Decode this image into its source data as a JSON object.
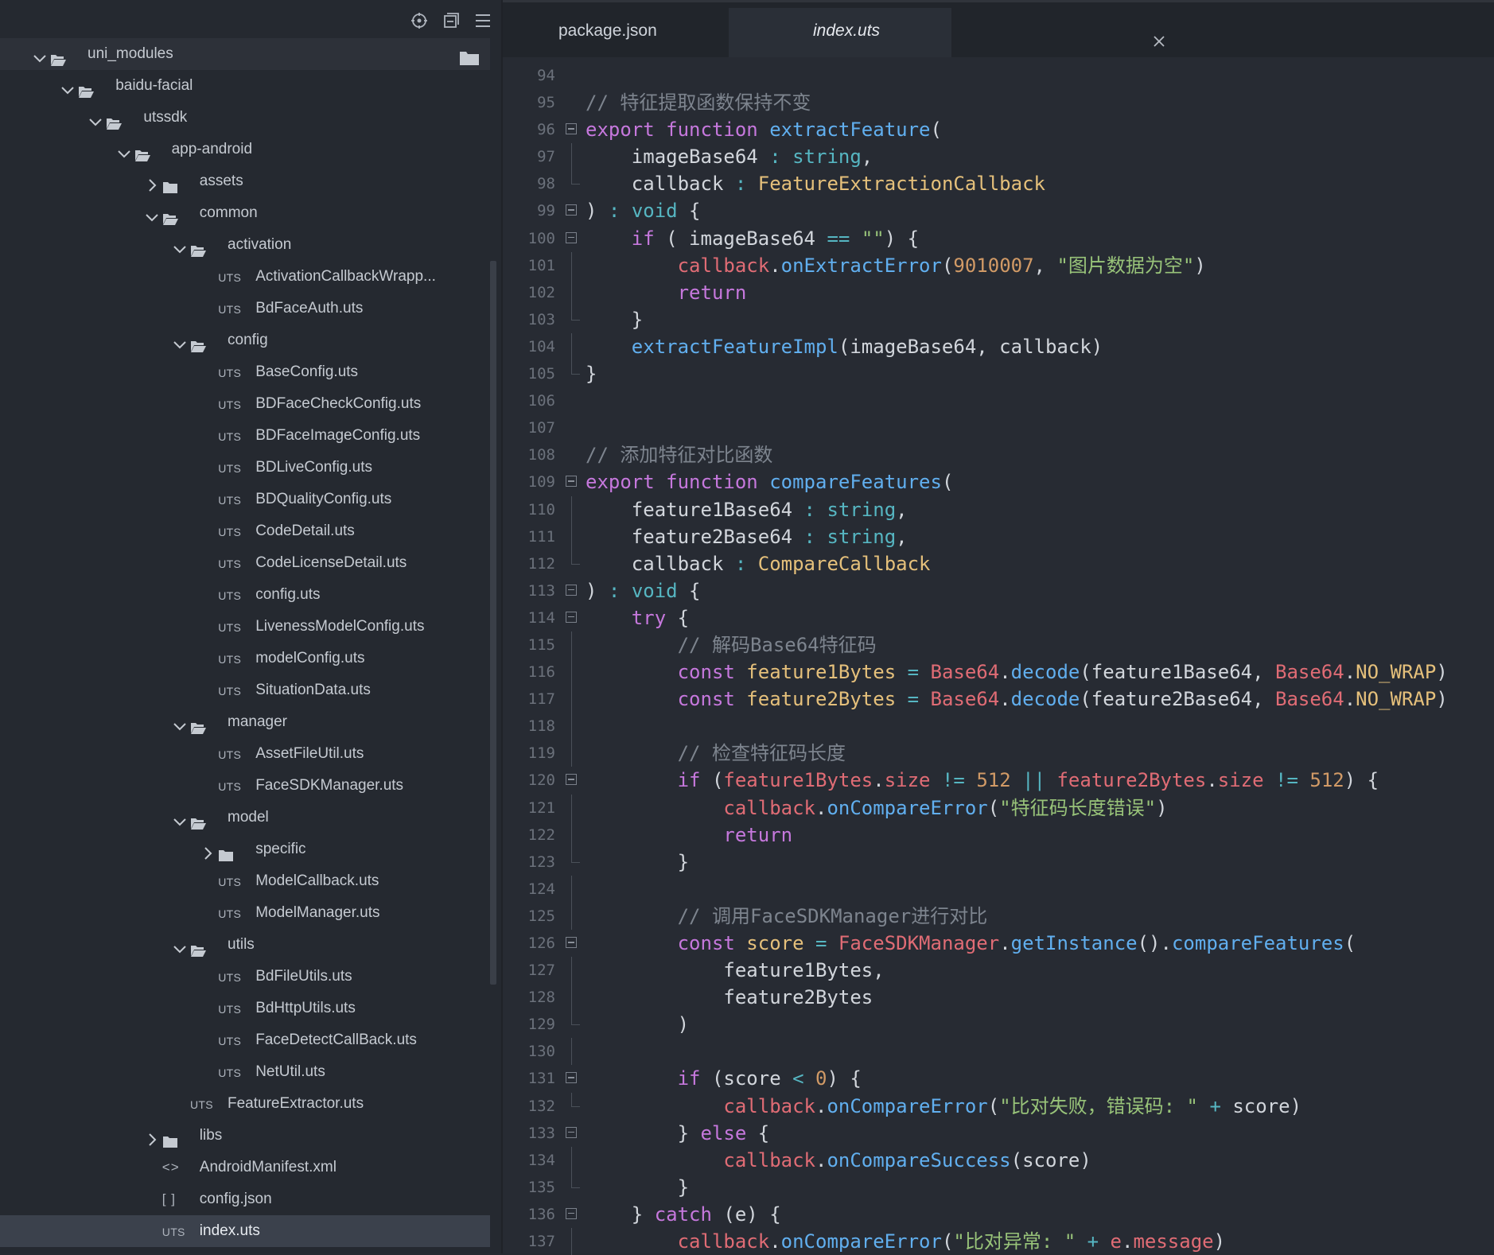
{
  "sidebar": {
    "tree": [
      {
        "label": "uni_modules",
        "kind": "folder",
        "depth": 0,
        "state": "open",
        "end_folder_icon": true
      },
      {
        "label": "baidu-facial",
        "kind": "folder",
        "depth": 1,
        "state": "open"
      },
      {
        "label": "utssdk",
        "kind": "folder",
        "depth": 2,
        "state": "open"
      },
      {
        "label": "app-android",
        "kind": "folder",
        "depth": 3,
        "state": "open"
      },
      {
        "label": "assets",
        "kind": "folder",
        "depth": 4,
        "state": "closed"
      },
      {
        "label": "common",
        "kind": "folder",
        "depth": 4,
        "state": "open"
      },
      {
        "label": "activation",
        "kind": "folder",
        "depth": 5,
        "state": "open"
      },
      {
        "label": "ActivationCallbackWrapp...",
        "kind": "uts",
        "depth": 6
      },
      {
        "label": "BdFaceAuth.uts",
        "kind": "uts",
        "depth": 6
      },
      {
        "label": "config",
        "kind": "folder",
        "depth": 5,
        "state": "open"
      },
      {
        "label": "BaseConfig.uts",
        "kind": "uts",
        "depth": 6
      },
      {
        "label": "BDFaceCheckConfig.uts",
        "kind": "uts",
        "depth": 6
      },
      {
        "label": "BDFaceImageConfig.uts",
        "kind": "uts",
        "depth": 6
      },
      {
        "label": "BDLiveConfig.uts",
        "kind": "uts",
        "depth": 6
      },
      {
        "label": "BDQualityConfig.uts",
        "kind": "uts",
        "depth": 6
      },
      {
        "label": "CodeDetail.uts",
        "kind": "uts",
        "depth": 6
      },
      {
        "label": "CodeLicenseDetail.uts",
        "kind": "uts",
        "depth": 6
      },
      {
        "label": "config.uts",
        "kind": "uts",
        "depth": 6
      },
      {
        "label": "LivenessModelConfig.uts",
        "kind": "uts",
        "depth": 6
      },
      {
        "label": "modelConfig.uts",
        "kind": "uts",
        "depth": 6
      },
      {
        "label": "SituationData.uts",
        "kind": "uts",
        "depth": 6
      },
      {
        "label": "manager",
        "kind": "folder",
        "depth": 5,
        "state": "open"
      },
      {
        "label": "AssetFileUtil.uts",
        "kind": "uts",
        "depth": 6
      },
      {
        "label": "FaceSDKManager.uts",
        "kind": "uts",
        "depth": 6
      },
      {
        "label": "model",
        "kind": "folder",
        "depth": 5,
        "state": "open"
      },
      {
        "label": "specific",
        "kind": "folder",
        "depth": 6,
        "state": "closed"
      },
      {
        "label": "ModelCallback.uts",
        "kind": "uts",
        "depth": 6
      },
      {
        "label": "ModelManager.uts",
        "kind": "uts",
        "depth": 6
      },
      {
        "label": "utils",
        "kind": "folder",
        "depth": 5,
        "state": "open"
      },
      {
        "label": "BdFileUtils.uts",
        "kind": "uts",
        "depth": 6
      },
      {
        "label": "BdHttpUtils.uts",
        "kind": "uts",
        "depth": 6
      },
      {
        "label": "FaceDetectCallBack.uts",
        "kind": "uts",
        "depth": 6
      },
      {
        "label": "NetUtil.uts",
        "kind": "uts",
        "depth": 6
      },
      {
        "label": "FeatureExtractor.uts",
        "kind": "uts",
        "depth": 5
      },
      {
        "label": "libs",
        "kind": "folder",
        "depth": 4,
        "state": "closed"
      },
      {
        "label": "AndroidManifest.xml",
        "kind": "xml",
        "depth": 4
      },
      {
        "label": "config.json",
        "kind": "json",
        "depth": 4
      },
      {
        "label": "index.uts",
        "kind": "uts",
        "depth": 4,
        "selected": true
      }
    ],
    "uts_badge": "UTS",
    "json_badge": "[ ]",
    "xml_badge": "<>"
  },
  "tabs": [
    {
      "label": "package.json",
      "active": false
    },
    {
      "label": "index.uts",
      "active": true
    }
  ],
  "code_lines": [
    {
      "n": "94",
      "fold": "",
      "g": 0,
      "t": []
    },
    {
      "n": "95",
      "fold": "",
      "g": 0,
      "t": [
        [
          "cm",
          "// 特征提取函数保持不变"
        ]
      ]
    },
    {
      "n": "96",
      "fold": "box",
      "g": 0,
      "t": [
        [
          "kw",
          "export "
        ],
        [
          "kw",
          "function "
        ],
        [
          "fn",
          "extractFeature"
        ],
        [
          "pl",
          "("
        ]
      ]
    },
    {
      "n": "97",
      "fold": "guide",
      "g": 0,
      "t": [
        [
          "pl",
          "    imageBase64 "
        ],
        [
          "op",
          ": "
        ],
        [
          "ty",
          "string"
        ],
        [
          "pl",
          ","
        ]
      ]
    },
    {
      "n": "98",
      "fold": "end",
      "g": 0,
      "t": [
        [
          "pl",
          "    callback "
        ],
        [
          "op",
          ": "
        ],
        [
          "cls",
          "FeatureExtractionCallback"
        ]
      ]
    },
    {
      "n": "99",
      "fold": "box",
      "g": 0,
      "t": [
        [
          "pl",
          ") "
        ],
        [
          "op",
          ": "
        ],
        [
          "ty",
          "void"
        ],
        [
          "pl",
          " {"
        ]
      ]
    },
    {
      "n": "100",
      "fold": "box",
      "g": 0,
      "t": [
        [
          "pl",
          "    "
        ],
        [
          "kw",
          "if"
        ],
        [
          "pl",
          " ( imageBase64 "
        ],
        [
          "op",
          "=="
        ],
        [
          "pl",
          " "
        ],
        [
          "str",
          "\"\""
        ],
        [
          "pl",
          ") {"
        ]
      ]
    },
    {
      "n": "101",
      "fold": "guide",
      "g": 0,
      "t": [
        [
          "pl",
          "        "
        ],
        [
          "pr",
          "callback"
        ],
        [
          "pl",
          "."
        ],
        [
          "fn",
          "onExtractError"
        ],
        [
          "pl",
          "("
        ],
        [
          "num",
          "9010007"
        ],
        [
          "pl",
          ", "
        ],
        [
          "str",
          "\"图片数据为空\""
        ],
        [
          "pl",
          ")"
        ]
      ]
    },
    {
      "n": "102",
      "fold": "guide",
      "g": 0,
      "t": [
        [
          "pl",
          "        "
        ],
        [
          "kw",
          "return"
        ]
      ]
    },
    {
      "n": "103",
      "fold": "end",
      "g": 0,
      "t": [
        [
          "pl",
          "    }"
        ]
      ]
    },
    {
      "n": "104",
      "fold": "guide",
      "g": 0,
      "t": [
        [
          "pl",
          "    "
        ],
        [
          "fn",
          "extractFeatureImpl"
        ],
        [
          "pl",
          "(imageBase64, callback)"
        ]
      ]
    },
    {
      "n": "105",
      "fold": "end",
      "g": 0,
      "t": [
        [
          "pl",
          "}"
        ]
      ]
    },
    {
      "n": "106",
      "fold": "",
      "g": 0,
      "t": []
    },
    {
      "n": "107",
      "fold": "",
      "g": 0,
      "t": []
    },
    {
      "n": "108",
      "fold": "",
      "g": 0,
      "t": [
        [
          "cm",
          "// 添加特征对比函数"
        ]
      ]
    },
    {
      "n": "109",
      "fold": "box",
      "g": 0,
      "t": [
        [
          "kw",
          "export "
        ],
        [
          "kw",
          "function "
        ],
        [
          "fn",
          "compareFeatures"
        ],
        [
          "pl",
          "("
        ]
      ]
    },
    {
      "n": "110",
      "fold": "guide",
      "g": 0,
      "t": [
        [
          "pl",
          "    feature1Base64 "
        ],
        [
          "op",
          ": "
        ],
        [
          "ty",
          "string"
        ],
        [
          "pl",
          ","
        ]
      ]
    },
    {
      "n": "111",
      "fold": "guide",
      "g": 0,
      "t": [
        [
          "pl",
          "    feature2Base64 "
        ],
        [
          "op",
          ": "
        ],
        [
          "ty",
          "string"
        ],
        [
          "pl",
          ","
        ]
      ]
    },
    {
      "n": "112",
      "fold": "end",
      "g": 0,
      "t": [
        [
          "pl",
          "    callback "
        ],
        [
          "op",
          ": "
        ],
        [
          "cls",
          "CompareCallback"
        ]
      ]
    },
    {
      "n": "113",
      "fold": "box",
      "g": 0,
      "t": [
        [
          "pl",
          ") "
        ],
        [
          "op",
          ": "
        ],
        [
          "ty",
          "void"
        ],
        [
          "pl",
          " {"
        ]
      ]
    },
    {
      "n": "114",
      "fold": "box",
      "g": 0,
      "t": [
        [
          "pl",
          "    "
        ],
        [
          "kw",
          "try"
        ],
        [
          "pl",
          " {"
        ]
      ]
    },
    {
      "n": "115",
      "fold": "guide",
      "g": 0,
      "t": [
        [
          "pl",
          "        "
        ],
        [
          "cm",
          "// 解码Base64特征码"
        ]
      ]
    },
    {
      "n": "116",
      "fold": "guide",
      "g": 0,
      "t": [
        [
          "pl",
          "        "
        ],
        [
          "kw",
          "const "
        ],
        [
          "cls",
          "feature1Bytes "
        ],
        [
          "op",
          "= "
        ],
        [
          "pr",
          "Base64"
        ],
        [
          "pl",
          "."
        ],
        [
          "fn",
          "decode"
        ],
        [
          "pl",
          "(feature1Base64, "
        ],
        [
          "pr",
          "Base64"
        ],
        [
          "pl",
          "."
        ],
        [
          "cls",
          "NO_WRAP"
        ],
        [
          "pl",
          ")"
        ]
      ]
    },
    {
      "n": "117",
      "fold": "guide",
      "g": 0,
      "t": [
        [
          "pl",
          "        "
        ],
        [
          "kw",
          "const "
        ],
        [
          "cls",
          "feature2Bytes "
        ],
        [
          "op",
          "= "
        ],
        [
          "pr",
          "Base64"
        ],
        [
          "pl",
          "."
        ],
        [
          "fn",
          "decode"
        ],
        [
          "pl",
          "(feature2Base64, "
        ],
        [
          "pr",
          "Base64"
        ],
        [
          "pl",
          "."
        ],
        [
          "cls",
          "NO_WRAP"
        ],
        [
          "pl",
          ")"
        ]
      ]
    },
    {
      "n": "118",
      "fold": "guide",
      "g": 0,
      "t": []
    },
    {
      "n": "119",
      "fold": "guide",
      "g": 0,
      "t": [
        [
          "pl",
          "        "
        ],
        [
          "cm",
          "// 检查特征码长度"
        ]
      ]
    },
    {
      "n": "120",
      "fold": "box",
      "g": 0,
      "t": [
        [
          "pl",
          "        "
        ],
        [
          "kw",
          "if"
        ],
        [
          "pl",
          " ("
        ],
        [
          "pr",
          "feature1Bytes"
        ],
        [
          "pl",
          "."
        ],
        [
          "pr",
          "size"
        ],
        [
          "pl",
          " "
        ],
        [
          "op",
          "!="
        ],
        [
          "pl",
          " "
        ],
        [
          "num",
          "512"
        ],
        [
          "pl",
          " "
        ],
        [
          "op",
          "||"
        ],
        [
          "pl",
          " "
        ],
        [
          "pr",
          "feature2Bytes"
        ],
        [
          "pl",
          "."
        ],
        [
          "pr",
          "size"
        ],
        [
          "pl",
          " "
        ],
        [
          "op",
          "!="
        ],
        [
          "pl",
          " "
        ],
        [
          "num",
          "512"
        ],
        [
          "pl",
          ") {"
        ]
      ]
    },
    {
      "n": "121",
      "fold": "guide",
      "g": 0,
      "t": [
        [
          "pl",
          "            "
        ],
        [
          "pr",
          "callback"
        ],
        [
          "pl",
          "."
        ],
        [
          "fn",
          "onCompareError"
        ],
        [
          "pl",
          "("
        ],
        [
          "str",
          "\"特征码长度错误\""
        ],
        [
          "pl",
          ")"
        ]
      ]
    },
    {
      "n": "122",
      "fold": "guide",
      "g": 0,
      "t": [
        [
          "pl",
          "            "
        ],
        [
          "kw",
          "return"
        ]
      ]
    },
    {
      "n": "123",
      "fold": "end",
      "g": 0,
      "t": [
        [
          "pl",
          "        }"
        ]
      ]
    },
    {
      "n": "124",
      "fold": "guide",
      "g": 0,
      "t": []
    },
    {
      "n": "125",
      "fold": "guide",
      "g": 0,
      "t": [
        [
          "pl",
          "        "
        ],
        [
          "cm",
          "// 调用FaceSDKManager进行对比"
        ]
      ]
    },
    {
      "n": "126",
      "fold": "box",
      "g": 0,
      "t": [
        [
          "pl",
          "        "
        ],
        [
          "kw",
          "const "
        ],
        [
          "cls",
          "score "
        ],
        [
          "op",
          "= "
        ],
        [
          "pr",
          "FaceSDKManager"
        ],
        [
          "pl",
          "."
        ],
        [
          "fn",
          "getInstance"
        ],
        [
          "pl",
          "()."
        ],
        [
          "fn",
          "compareFeatures"
        ],
        [
          "pl",
          "("
        ]
      ]
    },
    {
      "n": "127",
      "fold": "guide",
      "g": 0,
      "t": [
        [
          "pl",
          "            feature1Bytes,"
        ]
      ]
    },
    {
      "n": "128",
      "fold": "guide",
      "g": 0,
      "t": [
        [
          "pl",
          "            feature2Bytes"
        ]
      ]
    },
    {
      "n": "129",
      "fold": "end",
      "g": 0,
      "t": [
        [
          "pl",
          "        )"
        ]
      ]
    },
    {
      "n": "130",
      "fold": "guide",
      "g": 0,
      "t": []
    },
    {
      "n": "131",
      "fold": "box",
      "g": 0,
      "t": [
        [
          "pl",
          "        "
        ],
        [
          "kw",
          "if"
        ],
        [
          "pl",
          " (score "
        ],
        [
          "op",
          "<"
        ],
        [
          "pl",
          " "
        ],
        [
          "num",
          "0"
        ],
        [
          "pl",
          ") {"
        ]
      ]
    },
    {
      "n": "132",
      "fold": "end",
      "g": 0,
      "t": [
        [
          "pl",
          "            "
        ],
        [
          "pr",
          "callback"
        ],
        [
          "pl",
          "."
        ],
        [
          "fn",
          "onCompareError"
        ],
        [
          "pl",
          "("
        ],
        [
          "str",
          "\"比对失败，错误码: \""
        ],
        [
          "pl",
          " "
        ],
        [
          "op",
          "+"
        ],
        [
          "pl",
          " score)"
        ]
      ]
    },
    {
      "n": "133",
      "fold": "box",
      "g": 0,
      "t": [
        [
          "pl",
          "        } "
        ],
        [
          "kw",
          "else"
        ],
        [
          "pl",
          " {"
        ]
      ]
    },
    {
      "n": "134",
      "fold": "guide",
      "g": 0,
      "t": [
        [
          "pl",
          "            "
        ],
        [
          "pr",
          "callback"
        ],
        [
          "pl",
          "."
        ],
        [
          "fn",
          "onCompareSuccess"
        ],
        [
          "pl",
          "(score)"
        ]
      ]
    },
    {
      "n": "135",
      "fold": "end",
      "g": 0,
      "t": [
        [
          "pl",
          "        }"
        ]
      ]
    },
    {
      "n": "136",
      "fold": "box",
      "g": 0,
      "t": [
        [
          "pl",
          "    } "
        ],
        [
          "kw",
          "catch"
        ],
        [
          "pl",
          " (e) {"
        ]
      ]
    },
    {
      "n": "137",
      "fold": "guide",
      "g": 0,
      "t": [
        [
          "pl",
          "        "
        ],
        [
          "pr",
          "callback"
        ],
        [
          "pl",
          "."
        ],
        [
          "fn",
          "onCompareError"
        ],
        [
          "pl",
          "("
        ],
        [
          "str",
          "\"比对异常: \""
        ],
        [
          "pl",
          " "
        ],
        [
          "op",
          "+"
        ],
        [
          "pl",
          " "
        ],
        [
          "pr",
          "e"
        ],
        [
          "pl",
          "."
        ],
        [
          "pr",
          "message"
        ],
        [
          "pl",
          ")"
        ]
      ]
    }
  ],
  "colors": {
    "sidebar_bg": "#252930",
    "editor_bg": "#272b33",
    "selection": "#3b414c",
    "keyword": "#c678dd",
    "function": "#61afef",
    "type": "#56b6c2",
    "class": "#e5c07b",
    "string": "#98c379",
    "number": "#d19a66",
    "property": "#e06c75",
    "comment": "#7d848e"
  }
}
